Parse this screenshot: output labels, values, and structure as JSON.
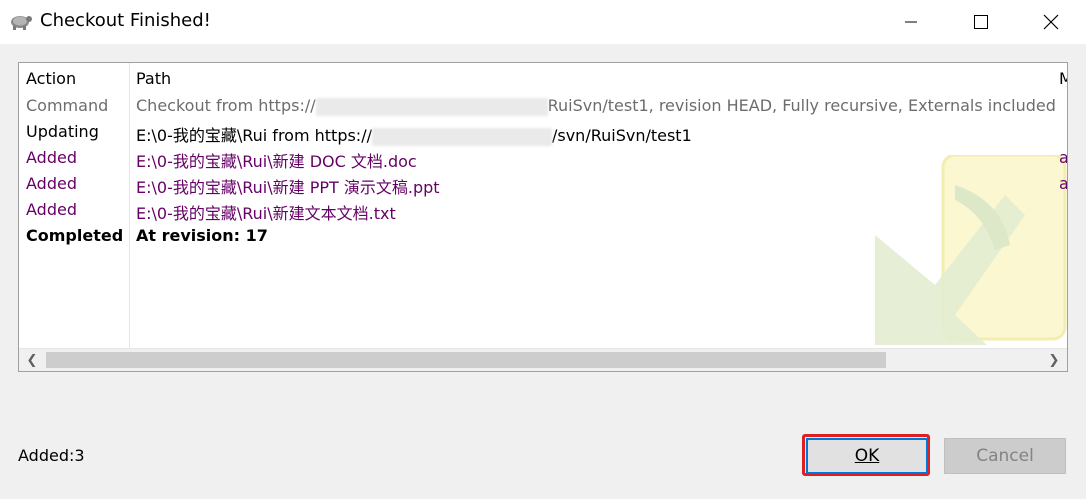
{
  "window": {
    "title": "Checkout Finished!",
    "icon": "tortoise-svn-icon"
  },
  "table": {
    "headers": [
      "Action",
      "Path",
      "M"
    ],
    "rows": [
      {
        "action": "Command",
        "path_pre": "Checkout from https://",
        "path_post": "RuiSvn/test1, revision HEAD, Fully recursive, Externals included",
        "style": "gray"
      },
      {
        "action": "Updating",
        "path_pre": "E:\\0-我的宝藏\\Rui from https://",
        "path_post": "/svn/RuiSvn/test1",
        "style": "normal"
      },
      {
        "action": "Added",
        "path_pre": "E:\\0-我的宝藏\\Rui\\新建 DOC 文档.doc",
        "path_post": "",
        "extra": "a",
        "style": "purple"
      },
      {
        "action": "Added",
        "path_pre": "E:\\0-我的宝藏\\Rui\\新建 PPT 演示文稿.ppt",
        "path_post": "",
        "extra": "a",
        "style": "purple"
      },
      {
        "action": "Added",
        "path_pre": "E:\\0-我的宝藏\\Rui\\新建文本文档.txt",
        "path_post": "",
        "style": "purple"
      },
      {
        "action": "Completed",
        "path_pre": "At revision: 17",
        "path_post": "",
        "style": "bold"
      }
    ]
  },
  "status": "Added:3",
  "buttons": {
    "ok": "OK",
    "cancel": "Cancel"
  },
  "colors": {
    "purple": "#660066",
    "gray": "#6d6d6d",
    "highlight": "#e02020",
    "focus": "#0078d7"
  }
}
